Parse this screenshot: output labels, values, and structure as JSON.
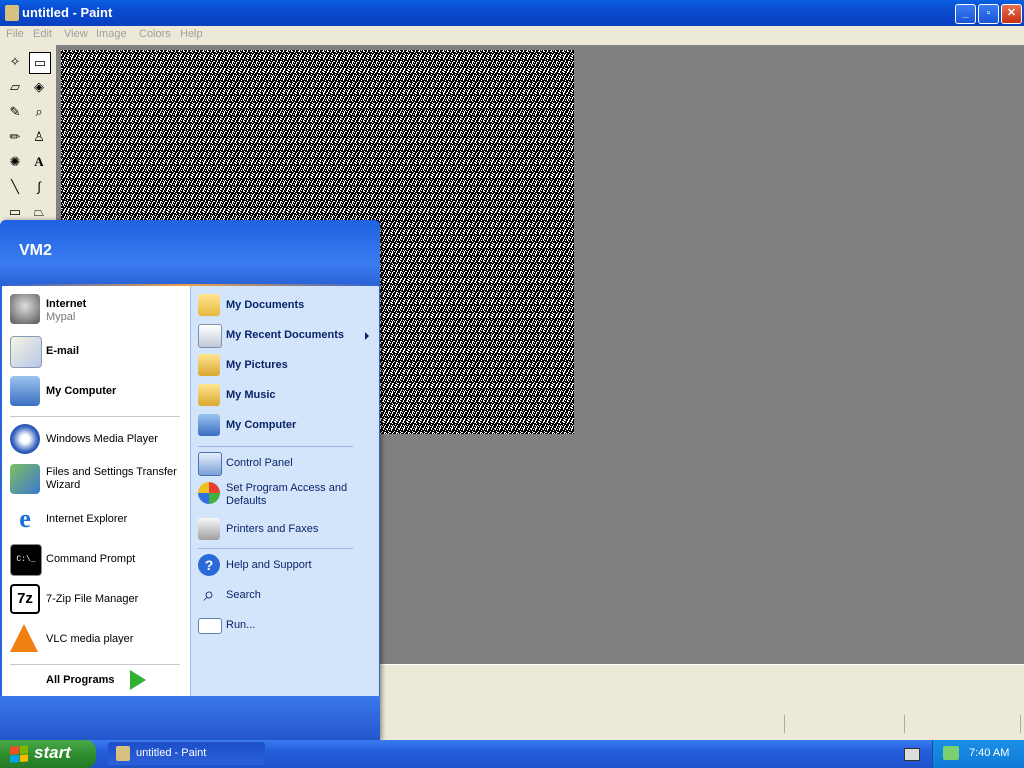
{
  "window": {
    "title": "untitled - Paint",
    "controls": {
      "minimize": "_",
      "maximize": "▫",
      "close": "✕"
    }
  },
  "menubar": [
    "File",
    "Edit",
    "View",
    "Image",
    "Colors",
    "Help"
  ],
  "toolbox": [
    {
      "icon": "free-select-icon",
      "glyph": "✧"
    },
    {
      "icon": "rect-select-icon",
      "glyph": "▭"
    },
    {
      "icon": "eraser-icon",
      "glyph": "▱"
    },
    {
      "icon": "fill-icon",
      "glyph": "◈"
    },
    {
      "icon": "color-picker-icon",
      "glyph": "✎"
    },
    {
      "icon": "magnifier-icon",
      "glyph": "⌕"
    },
    {
      "icon": "pencil-icon",
      "glyph": "✏"
    },
    {
      "icon": "brush-icon",
      "glyph": "♙"
    },
    {
      "icon": "airbrush-icon",
      "glyph": "✺"
    },
    {
      "icon": "text-icon",
      "glyph": "A"
    },
    {
      "icon": "line-icon",
      "glyph": "╲"
    },
    {
      "icon": "curve-icon",
      "glyph": "∫"
    },
    {
      "icon": "rectangle-icon",
      "glyph": "▭"
    },
    {
      "icon": "polygon-icon",
      "glyph": "⏢"
    }
  ],
  "start_menu": {
    "user": "VM2",
    "left": {
      "pinned": [
        {
          "label": "Internet",
          "sub": "Mypal",
          "icon": "raccoon-icon"
        },
        {
          "label": "E-mail",
          "sub": "",
          "icon": "email-icon"
        },
        {
          "label": "My Computer",
          "sub": "",
          "icon": "computer-icon"
        }
      ],
      "recent": [
        {
          "label": "Windows Media Player",
          "icon": "media-player-icon"
        },
        {
          "label": "Files and Settings Transfer Wizard",
          "icon": "transfer-wizard-icon"
        },
        {
          "label": "Internet Explorer",
          "icon": "ie-icon"
        },
        {
          "label": "Command Prompt",
          "icon": "cmd-icon"
        },
        {
          "label": "7-Zip File Manager",
          "icon": "7zip-icon"
        },
        {
          "label": "VLC media player",
          "icon": "vlc-icon"
        }
      ],
      "all_programs": "All Programs"
    },
    "right": {
      "places": [
        {
          "label": "My Documents",
          "icon": "folder-docs-icon"
        },
        {
          "label": "My Recent Documents",
          "icon": "recent-docs-icon"
        },
        {
          "label": "My Pictures",
          "icon": "folder-pictures-icon"
        },
        {
          "label": "My Music",
          "icon": "folder-music-icon"
        },
        {
          "label": "My Computer",
          "icon": "computer-icon"
        }
      ],
      "settings": [
        {
          "label": "Control Panel",
          "icon": "control-panel-icon"
        },
        {
          "label": "Set Program Access and Defaults",
          "icon": "program-access-icon"
        },
        {
          "label": "Printers and Faxes",
          "icon": "printer-icon"
        }
      ],
      "help": [
        {
          "label": "Help and Support",
          "icon": "help-icon"
        },
        {
          "label": "Search",
          "icon": "search-icon"
        },
        {
          "label": "Run...",
          "icon": "run-icon"
        }
      ]
    }
  },
  "taskbar": {
    "start": "start",
    "tasks": [
      {
        "label": "untitled - Paint",
        "icon": "paint-icon"
      }
    ],
    "clock": "7:40 AM"
  }
}
